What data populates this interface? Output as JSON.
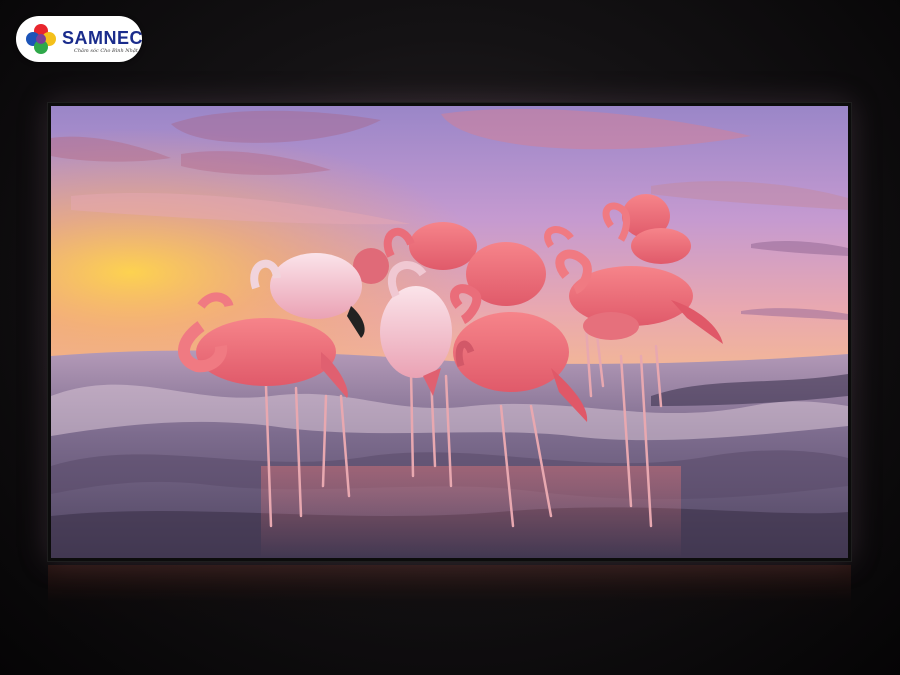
{
  "logo": {
    "brand_name": "SAMNEC",
    "tagline": "Chăm sóc Cho Bình Nhật"
  },
  "tv_screen": {
    "subject": "flamingos"
  },
  "colors": {
    "brand_blue": "#1a2c8c",
    "flamingo_pink": "#f0707a",
    "sky_purple": "#b694cc",
    "sunset_gold": "#f8c24a"
  }
}
